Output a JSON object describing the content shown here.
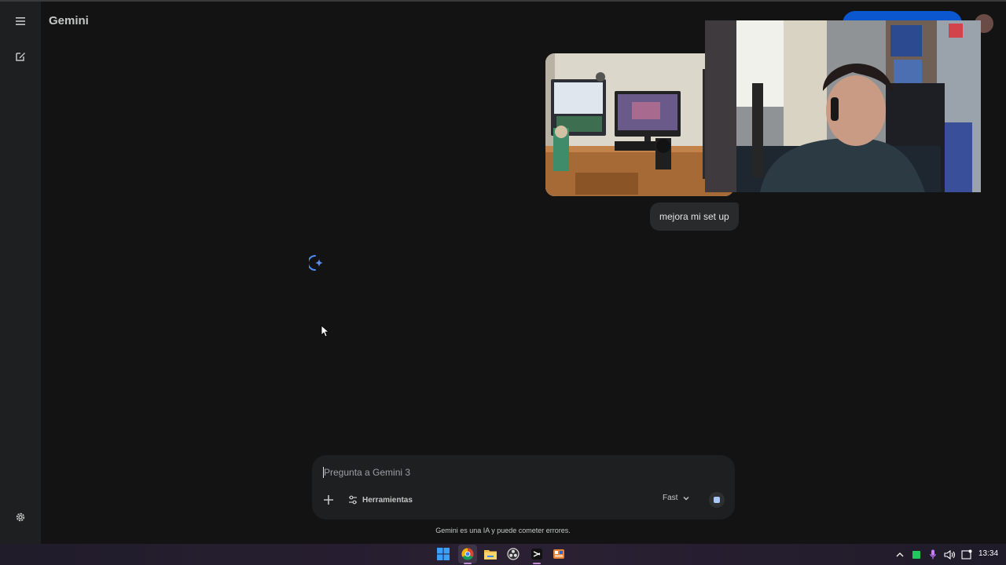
{
  "app": {
    "title": "Gemini"
  },
  "conversation": {
    "user_message": "mejora mi set up"
  },
  "composer": {
    "placeholder": "Pregunta a Gemini 3",
    "tools_label": "Herramientas",
    "model_label": "Fast"
  },
  "footer": {
    "disclaimer": "Gemini es una IA y puede cometer errores."
  },
  "taskbar": {
    "clock": "13:34",
    "apps": [
      "windows-start-icon",
      "chrome-icon",
      "file-explorer-icon",
      "obs-icon",
      "capcut-icon",
      "app-icon"
    ],
    "tray": [
      "chevron-up-icon",
      "battery-icon",
      "microphone-icon",
      "speaker-icon",
      "notification-icon"
    ]
  },
  "colors": {
    "background": "#131314",
    "rail": "#1e1f20",
    "accent": "#0b57d0",
    "stop": "#a8c7fa"
  }
}
